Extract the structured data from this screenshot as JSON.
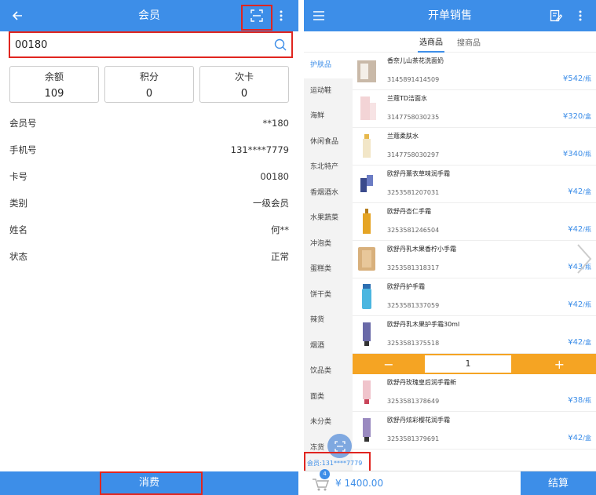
{
  "left": {
    "title": "会员",
    "search_value": "00180",
    "stats": [
      {
        "label": "余额",
        "value": "109"
      },
      {
        "label": "积分",
        "value": "0"
      },
      {
        "label": "次卡",
        "value": "0"
      }
    ],
    "info": [
      {
        "label": "会员号",
        "value": "**180"
      },
      {
        "label": "手机号",
        "value": "131****7779"
      },
      {
        "label": "卡号",
        "value": "00180"
      },
      {
        "label": "类别",
        "value": "一级会员"
      },
      {
        "label": "姓名",
        "value": "何**"
      },
      {
        "label": "状态",
        "value": "正常"
      }
    ],
    "consume_label": "消费"
  },
  "right": {
    "title": "开单销售",
    "tabs": [
      "选商品",
      "搜商品"
    ],
    "categories": [
      "护肤品",
      "运动鞋",
      "海鲜",
      "休闲食品",
      "东北特产",
      "香烟酒水",
      "水果蔬菜",
      "冲泡类",
      "蛋糕类",
      "饼干类",
      "辣货",
      "烟酒",
      "饮品类",
      "面类",
      "未分类",
      "冻货"
    ],
    "products": [
      {
        "name": "香奈儿山茶花洗面奶",
        "code": "3145891414509",
        "price": "¥542",
        "unit": "/瓶"
      },
      {
        "name": "兰蔻TD洁面水",
        "code": "3147758030235",
        "price": "¥320",
        "unit": "/盒"
      },
      {
        "name": "兰蔻柔肤水",
        "code": "3147758030297",
        "price": "¥340",
        "unit": "/瓶"
      },
      {
        "name": "欧舒丹薰衣草味润手霜",
        "code": "3253581207031",
        "price": "¥42",
        "unit": "/盒"
      },
      {
        "name": "欧舒丹杏仁手霜",
        "code": "3253581246504",
        "price": "¥42",
        "unit": "/瓶"
      },
      {
        "name": "欧舒丹乳木果香柠小手霜",
        "code": "3253581318317",
        "price": "¥43",
        "unit": "/瓶"
      },
      {
        "name": "欧舒丹护手霜",
        "code": "3253581337059",
        "price": "¥42",
        "unit": "/瓶"
      },
      {
        "name": "欧舒丹乳木果护手霜30ml",
        "code": "3253581375518",
        "price": "¥42",
        "unit": "/盒"
      },
      {
        "name": "欧舒丹玫瑰皇后润手霜新",
        "code": "3253581378649",
        "price": "¥38",
        "unit": "/瓶"
      },
      {
        "name": "欧舒丹炫彩樱花润手霜",
        "code": "3253581379691",
        "price": "¥42",
        "unit": "/盒"
      }
    ],
    "qty_minus": "−",
    "qty_value": "1",
    "qty_plus": "+",
    "member_label": "会员:131****7779",
    "cart_count": "4",
    "total": "¥ 1400.00",
    "checkout_label": "结算"
  }
}
